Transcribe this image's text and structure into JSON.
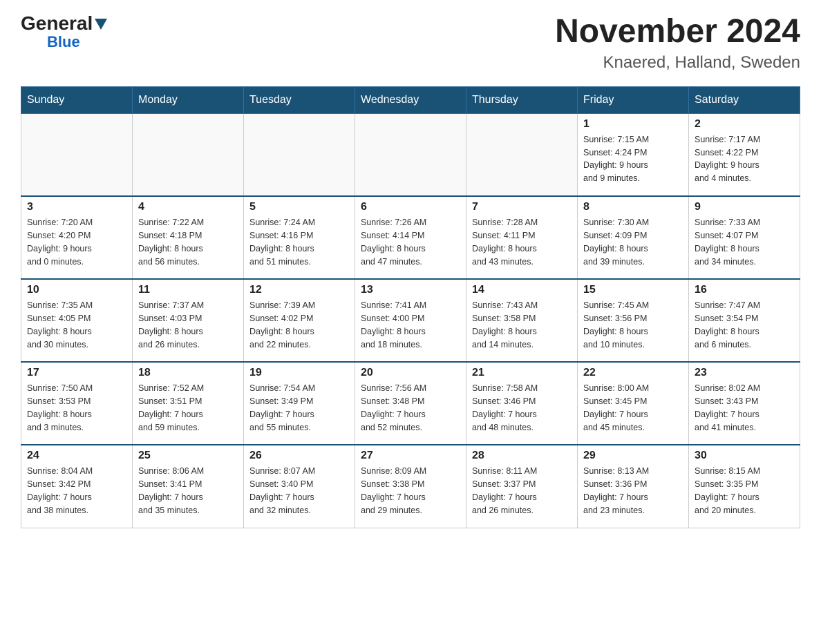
{
  "logo": {
    "general": "General",
    "blue": "Blue"
  },
  "title": "November 2024",
  "subtitle": "Knaered, Halland, Sweden",
  "headers": [
    "Sunday",
    "Monday",
    "Tuesday",
    "Wednesday",
    "Thursday",
    "Friday",
    "Saturday"
  ],
  "weeks": [
    [
      {
        "day": "",
        "info": ""
      },
      {
        "day": "",
        "info": ""
      },
      {
        "day": "",
        "info": ""
      },
      {
        "day": "",
        "info": ""
      },
      {
        "day": "",
        "info": ""
      },
      {
        "day": "1",
        "info": "Sunrise: 7:15 AM\nSunset: 4:24 PM\nDaylight: 9 hours\nand 9 minutes."
      },
      {
        "day": "2",
        "info": "Sunrise: 7:17 AM\nSunset: 4:22 PM\nDaylight: 9 hours\nand 4 minutes."
      }
    ],
    [
      {
        "day": "3",
        "info": "Sunrise: 7:20 AM\nSunset: 4:20 PM\nDaylight: 9 hours\nand 0 minutes."
      },
      {
        "day": "4",
        "info": "Sunrise: 7:22 AM\nSunset: 4:18 PM\nDaylight: 8 hours\nand 56 minutes."
      },
      {
        "day": "5",
        "info": "Sunrise: 7:24 AM\nSunset: 4:16 PM\nDaylight: 8 hours\nand 51 minutes."
      },
      {
        "day": "6",
        "info": "Sunrise: 7:26 AM\nSunset: 4:14 PM\nDaylight: 8 hours\nand 47 minutes."
      },
      {
        "day": "7",
        "info": "Sunrise: 7:28 AM\nSunset: 4:11 PM\nDaylight: 8 hours\nand 43 minutes."
      },
      {
        "day": "8",
        "info": "Sunrise: 7:30 AM\nSunset: 4:09 PM\nDaylight: 8 hours\nand 39 minutes."
      },
      {
        "day": "9",
        "info": "Sunrise: 7:33 AM\nSunset: 4:07 PM\nDaylight: 8 hours\nand 34 minutes."
      }
    ],
    [
      {
        "day": "10",
        "info": "Sunrise: 7:35 AM\nSunset: 4:05 PM\nDaylight: 8 hours\nand 30 minutes."
      },
      {
        "day": "11",
        "info": "Sunrise: 7:37 AM\nSunset: 4:03 PM\nDaylight: 8 hours\nand 26 minutes."
      },
      {
        "day": "12",
        "info": "Sunrise: 7:39 AM\nSunset: 4:02 PM\nDaylight: 8 hours\nand 22 minutes."
      },
      {
        "day": "13",
        "info": "Sunrise: 7:41 AM\nSunset: 4:00 PM\nDaylight: 8 hours\nand 18 minutes."
      },
      {
        "day": "14",
        "info": "Sunrise: 7:43 AM\nSunset: 3:58 PM\nDaylight: 8 hours\nand 14 minutes."
      },
      {
        "day": "15",
        "info": "Sunrise: 7:45 AM\nSunset: 3:56 PM\nDaylight: 8 hours\nand 10 minutes."
      },
      {
        "day": "16",
        "info": "Sunrise: 7:47 AM\nSunset: 3:54 PM\nDaylight: 8 hours\nand 6 minutes."
      }
    ],
    [
      {
        "day": "17",
        "info": "Sunrise: 7:50 AM\nSunset: 3:53 PM\nDaylight: 8 hours\nand 3 minutes."
      },
      {
        "day": "18",
        "info": "Sunrise: 7:52 AM\nSunset: 3:51 PM\nDaylight: 7 hours\nand 59 minutes."
      },
      {
        "day": "19",
        "info": "Sunrise: 7:54 AM\nSunset: 3:49 PM\nDaylight: 7 hours\nand 55 minutes."
      },
      {
        "day": "20",
        "info": "Sunrise: 7:56 AM\nSunset: 3:48 PM\nDaylight: 7 hours\nand 52 minutes."
      },
      {
        "day": "21",
        "info": "Sunrise: 7:58 AM\nSunset: 3:46 PM\nDaylight: 7 hours\nand 48 minutes."
      },
      {
        "day": "22",
        "info": "Sunrise: 8:00 AM\nSunset: 3:45 PM\nDaylight: 7 hours\nand 45 minutes."
      },
      {
        "day": "23",
        "info": "Sunrise: 8:02 AM\nSunset: 3:43 PM\nDaylight: 7 hours\nand 41 minutes."
      }
    ],
    [
      {
        "day": "24",
        "info": "Sunrise: 8:04 AM\nSunset: 3:42 PM\nDaylight: 7 hours\nand 38 minutes."
      },
      {
        "day": "25",
        "info": "Sunrise: 8:06 AM\nSunset: 3:41 PM\nDaylight: 7 hours\nand 35 minutes."
      },
      {
        "day": "26",
        "info": "Sunrise: 8:07 AM\nSunset: 3:40 PM\nDaylight: 7 hours\nand 32 minutes."
      },
      {
        "day": "27",
        "info": "Sunrise: 8:09 AM\nSunset: 3:38 PM\nDaylight: 7 hours\nand 29 minutes."
      },
      {
        "day": "28",
        "info": "Sunrise: 8:11 AM\nSunset: 3:37 PM\nDaylight: 7 hours\nand 26 minutes."
      },
      {
        "day": "29",
        "info": "Sunrise: 8:13 AM\nSunset: 3:36 PM\nDaylight: 7 hours\nand 23 minutes."
      },
      {
        "day": "30",
        "info": "Sunrise: 8:15 AM\nSunset: 3:35 PM\nDaylight: 7 hours\nand 20 minutes."
      }
    ]
  ]
}
